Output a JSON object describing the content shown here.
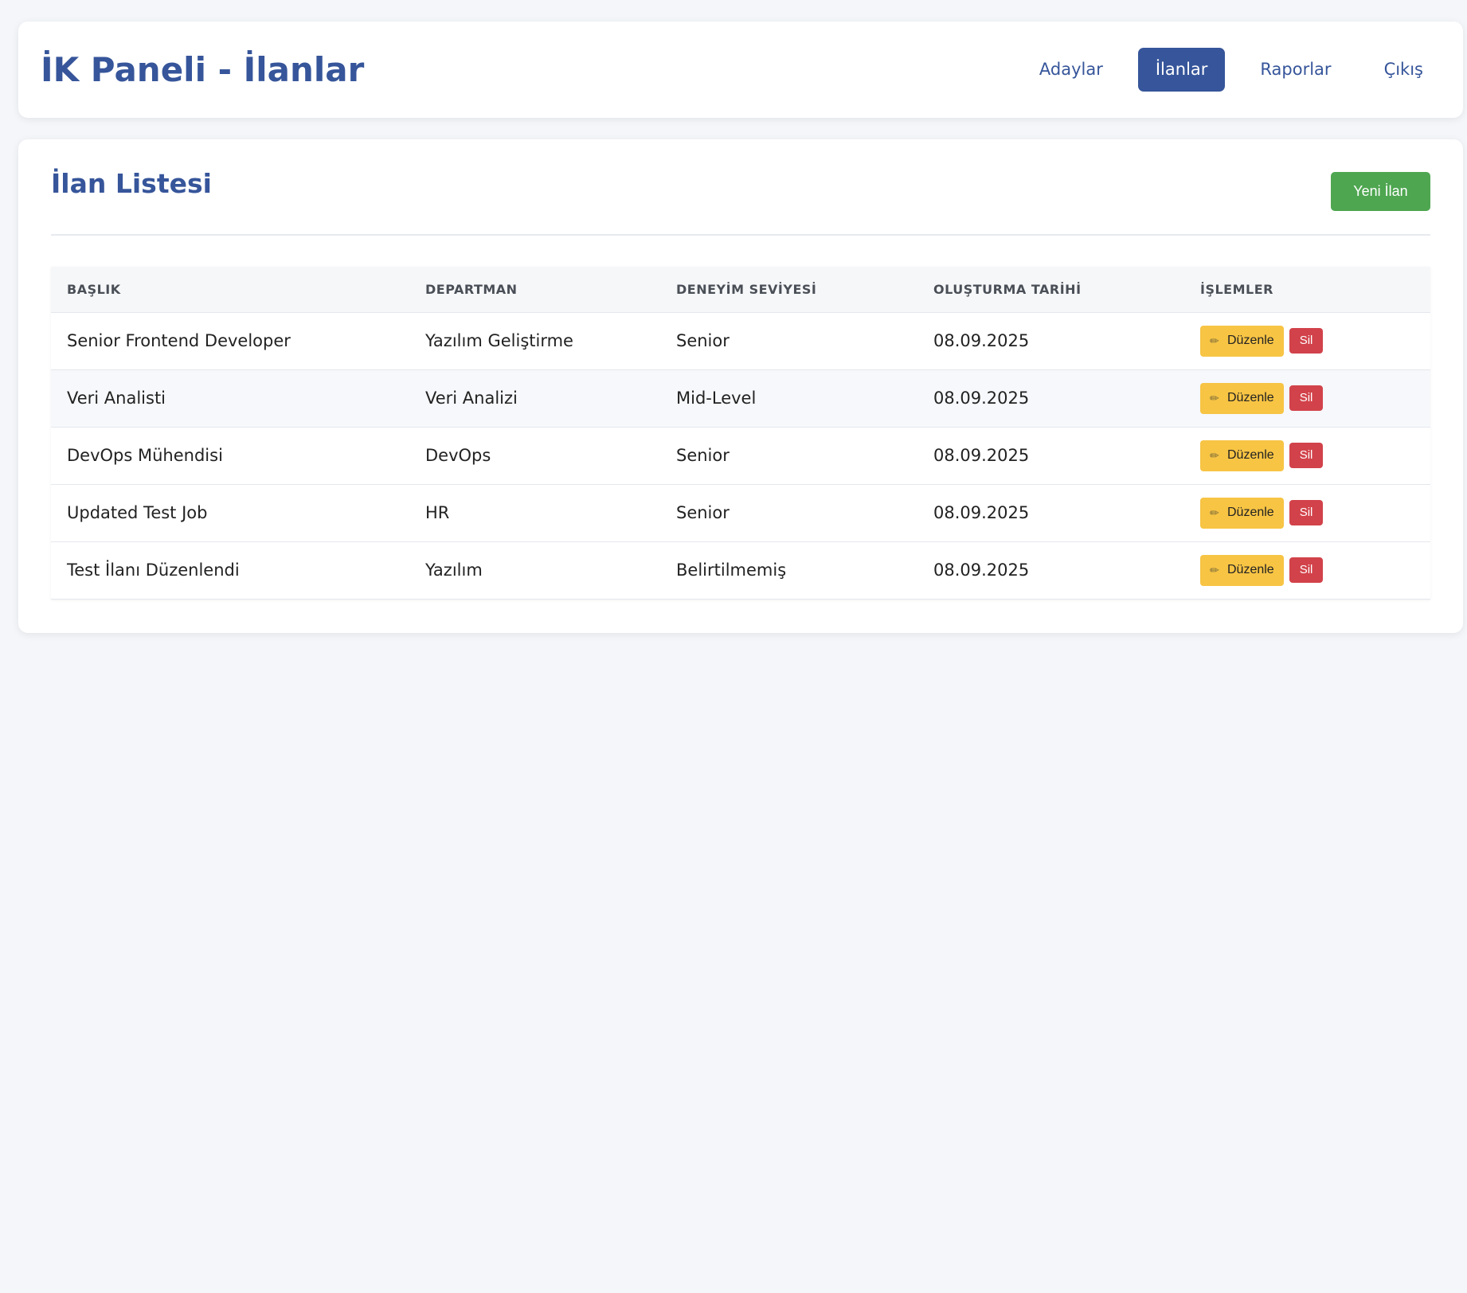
{
  "header": {
    "title": "İK Paneli - İlanlar",
    "nav": [
      {
        "label": "Adaylar",
        "active": false
      },
      {
        "label": "İlanlar",
        "active": true
      },
      {
        "label": "Raporlar",
        "active": false
      },
      {
        "label": "Çıkış",
        "active": false
      }
    ]
  },
  "main": {
    "title": "İlan Listesi",
    "new_button": "Yeni İlan",
    "table": {
      "columns": [
        "BAŞLIK",
        "DEPARTMAN",
        "DENEYİM SEVİYESİ",
        "OLUŞTURMA TARİHİ",
        "İŞLEMLER"
      ],
      "rows": [
        {
          "title": "Senior Frontend Developer",
          "department": "Yazılım Geliştirme",
          "level": "Senior",
          "date": "08.09.2025"
        },
        {
          "title": "Veri Analisti",
          "department": "Veri Analizi",
          "level": "Mid-Level",
          "date": "08.09.2025"
        },
        {
          "title": "DevOps Mühendisi",
          "department": "DevOps",
          "level": "Senior",
          "date": "08.09.2025"
        },
        {
          "title": "Updated Test Job",
          "department": "HR",
          "level": "Senior",
          "date": "08.09.2025"
        },
        {
          "title": "Test İlanı Düzenlendi",
          "department": "Yazılım",
          "level": "Belirtilmemiş",
          "date": "08.09.2025"
        }
      ],
      "edit_label": "Düzenle",
      "delete_label": "Sil",
      "edit_icon": "pencil-icon"
    }
  },
  "colors": {
    "primary": "#36559a",
    "success": "#4ea650",
    "warning": "#f7c444",
    "danger": "#d2424a",
    "background": "#f4f6fa"
  }
}
